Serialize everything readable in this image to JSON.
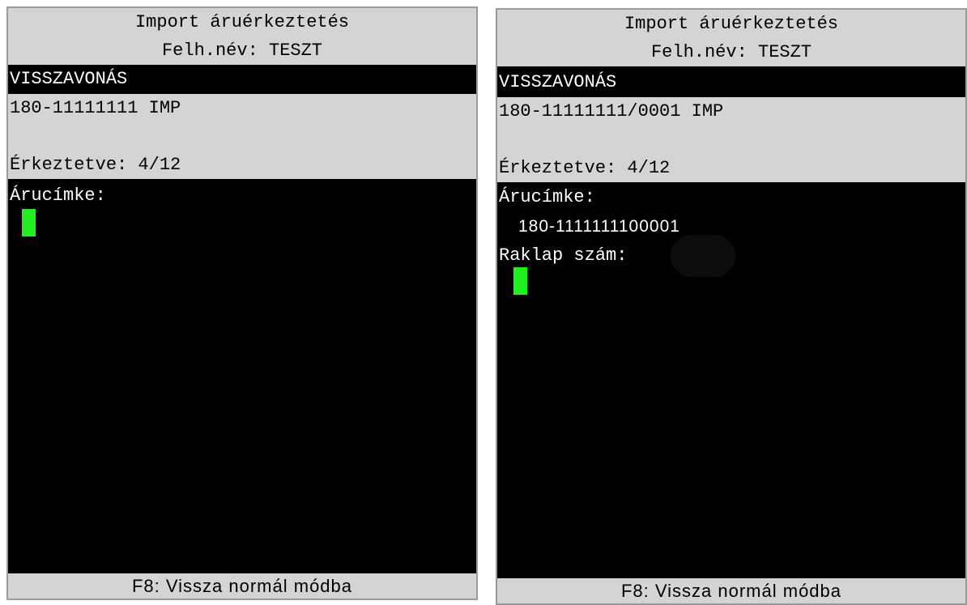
{
  "screens": [
    {
      "header": {
        "title": "Import áruérkeztetés",
        "user": "Felh.név: TESZT"
      },
      "mode": "VISSZAVONÁS",
      "shipment": "180-11111111 IMP",
      "received": "Érkeztetve: 4/12",
      "label_prompt": "Árucímke:",
      "footer": "F8: Vissza normál módba"
    },
    {
      "header": {
        "title": "Import áruérkeztetés",
        "user": "Felh.név: TESZT"
      },
      "mode": "VISSZAVONÁS",
      "shipment": "180-11111111/0001 IMP",
      "received": "Érkeztetve: 4/12",
      "label_prompt": "Árucímke:",
      "label_value": "180-1111111100001",
      "pallet_prompt": "Raklap szám:",
      "footer": "F8: Vissza normál módba"
    }
  ],
  "colors": {
    "screen_bg": "#000000",
    "panel_bg": "#d4d4d4",
    "text_light": "#ffffff",
    "text_dark": "#000000",
    "cursor": "#22ee22"
  }
}
